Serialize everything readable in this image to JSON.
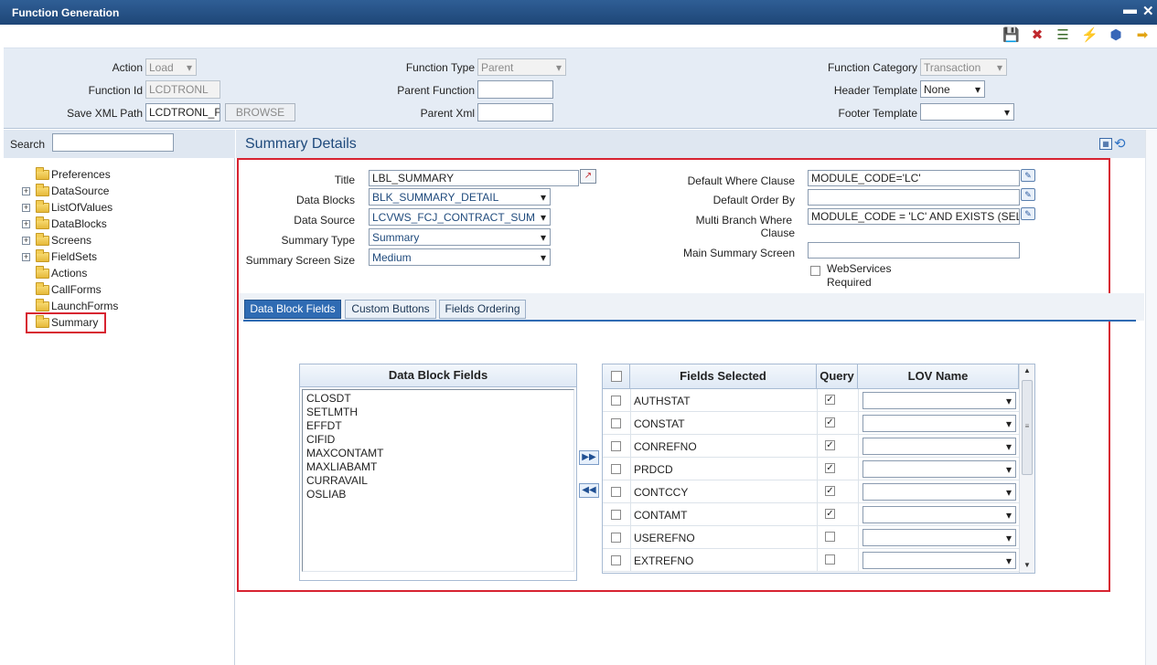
{
  "window": {
    "title": "Function Generation",
    "min_glyph": "▬",
    "close_glyph": "✕"
  },
  "toolbar": {
    "icons": [
      {
        "name": "save-icon",
        "glyph": "💾"
      },
      {
        "name": "delete-icon",
        "glyph": "✖"
      },
      {
        "name": "list-icon",
        "glyph": "☰"
      },
      {
        "name": "generate-icon",
        "glyph": "⚡"
      },
      {
        "name": "deploy-icon",
        "glyph": "⬢"
      },
      {
        "name": "exit-icon",
        "glyph": "➡"
      }
    ]
  },
  "header": {
    "action_label": "Action",
    "action_value": "Load",
    "function_id_label": "Function Id",
    "function_id_value": "LCDTRONL",
    "save_xml_path_label": "Save XML Path",
    "save_xml_path_value": "LCDTRONL_F",
    "browse_label": "BROWSE",
    "function_type_label": "Function Type",
    "function_type_value": "Parent",
    "parent_function_label": "Parent Function",
    "parent_function_value": "",
    "parent_xml_label": "Parent Xml",
    "parent_xml_value": "",
    "function_category_label": "Function Category",
    "function_category_value": "Transaction",
    "header_template_label": "Header Template",
    "header_template_value": "None",
    "footer_template_label": "Footer Template",
    "footer_template_value": ""
  },
  "sidebar": {
    "search_label": "Search",
    "search_value": "",
    "items": [
      {
        "label": "Preferences",
        "expandable": false
      },
      {
        "label": "DataSource",
        "expandable": true
      },
      {
        "label": "ListOfValues",
        "expandable": true
      },
      {
        "label": "DataBlocks",
        "expandable": true
      },
      {
        "label": "Screens",
        "expandable": true
      },
      {
        "label": "FieldSets",
        "expandable": true
      },
      {
        "label": "Actions",
        "expandable": false
      },
      {
        "label": "CallForms",
        "expandable": false
      },
      {
        "label": "LaunchForms",
        "expandable": false
      },
      {
        "label": "Summary",
        "expandable": false,
        "selected": true
      }
    ]
  },
  "main": {
    "title": "Summary Details",
    "form": {
      "title_label": "Title",
      "title_value": "LBL_SUMMARY",
      "data_blocks_label": "Data Blocks",
      "data_blocks_value": "BLK_SUMMARY_DETAIL",
      "data_source_label": "Data Source",
      "data_source_value": "LCVWS_FCJ_CONTRACT_SUM",
      "summary_type_label": "Summary Type",
      "summary_type_value": "Summary",
      "summary_screen_size_label": "Summary Screen Size",
      "summary_screen_size_value": "Medium",
      "default_where_label": "Default Where Clause",
      "default_where_value": "MODULE_CODE='LC'",
      "default_order_label": "Default Order By",
      "default_order_value": "",
      "multi_branch_label_1": "Multi Branch Where",
      "multi_branch_label_2": "Clause",
      "multi_branch_value": "MODULE_CODE = 'LC' AND EXISTS (SEL",
      "main_summary_label": "Main Summary Screen",
      "main_summary_value": "",
      "webservices_label_1": "WebServices",
      "webservices_label_2": "Required"
    },
    "tabs": [
      {
        "label": "Data Block Fields",
        "active": true
      },
      {
        "label": "Custom Buttons",
        "active": false
      },
      {
        "label": "Fields Ordering",
        "active": false
      }
    ],
    "data_block_fields": {
      "header": "Data Block Fields",
      "items": [
        "CLOSDT",
        "SETLMTH",
        "EFFDT",
        "CIFID",
        "MAXCONTAMT",
        "MAXLIABAMT",
        "CURRAVAIL",
        "OSLIAB"
      ]
    },
    "move_right_glyph": "▶▶",
    "move_left_glyph": "◀◀",
    "fields_selected": {
      "col_fields": "Fields Selected",
      "col_query": "Query",
      "col_lov": "LOV Name",
      "rows": [
        {
          "field": "AUTHSTAT",
          "query": true
        },
        {
          "field": "CONSTAT",
          "query": true
        },
        {
          "field": "CONREFNO",
          "query": true
        },
        {
          "field": "PRDCD",
          "query": true
        },
        {
          "field": "CONTCCY",
          "query": true
        },
        {
          "field": "CONTAMT",
          "query": true
        },
        {
          "field": "USEREFNO",
          "query": false
        },
        {
          "field": "EXTREFNO",
          "query": false
        }
      ]
    }
  }
}
